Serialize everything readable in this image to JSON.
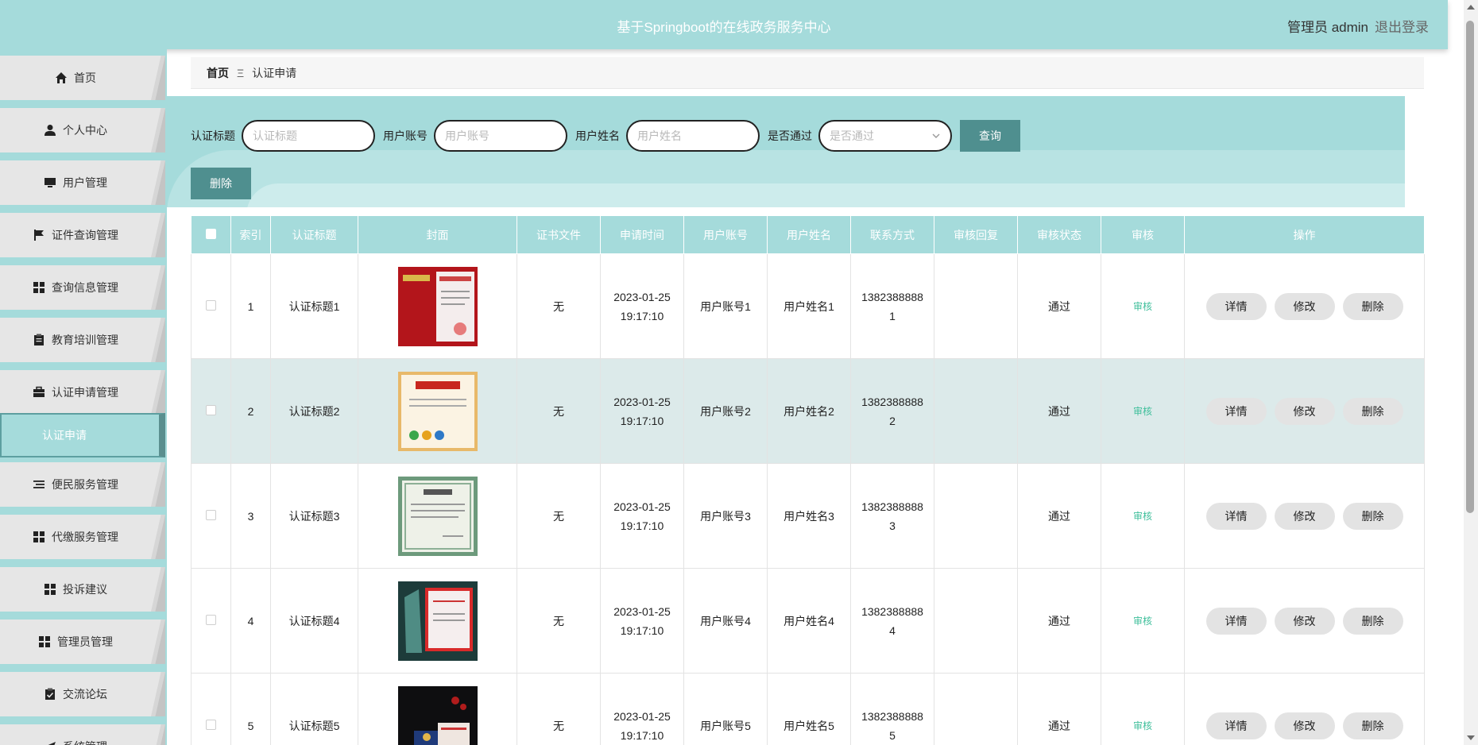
{
  "header": {
    "title": "基于Springboot的在线政务服务中心",
    "user_label": "管理员 admin",
    "logout_label": "退出登录",
    "color": "#a5dbdb"
  },
  "sidebar": {
    "items": [
      {
        "label": "首页",
        "icon": "home-icon"
      },
      {
        "label": "个人中心",
        "icon": "person-icon"
      },
      {
        "label": "用户管理",
        "icon": "monitor-icon"
      },
      {
        "label": "证件查询管理",
        "icon": "flag-icon"
      },
      {
        "label": "查询信息管理",
        "icon": "grid-icon"
      },
      {
        "label": "教育培训管理",
        "icon": "clipboard-icon"
      },
      {
        "label": "认证申请管理",
        "icon": "briefcase-icon"
      },
      {
        "label": "便民服务管理",
        "icon": "list-icon"
      },
      {
        "label": "代缴服务管理",
        "icon": "grid-icon"
      },
      {
        "label": "投诉建议",
        "icon": "grid-icon"
      },
      {
        "label": "管理员管理",
        "icon": "grid-icon"
      },
      {
        "label": "交流论坛",
        "icon": "clipboard-check-icon"
      },
      {
        "label": "系统管理",
        "icon": "send-icon"
      }
    ],
    "active_sub": "认证申请"
  },
  "breadcrumb": {
    "home": "首页",
    "separator": "Ξ",
    "current": "认证申请"
  },
  "search": {
    "fields": [
      {
        "label": "认证标题",
        "placeholder": "认证标题"
      },
      {
        "label": "用户账号",
        "placeholder": "用户账号"
      },
      {
        "label": "用户姓名",
        "placeholder": "用户姓名"
      }
    ],
    "select": {
      "label": "是否通过",
      "placeholder": "是否通过"
    },
    "query_label": "查询",
    "delete_label": "删除"
  },
  "table": {
    "headers": [
      "索引",
      "认证标题",
      "封面",
      "证书文件",
      "申请时间",
      "用户账号",
      "用户姓名",
      "联系方式",
      "审核回复",
      "审核状态",
      "审核",
      "操作"
    ],
    "rows": [
      {
        "index": "1",
        "title": "认证标题1",
        "file": "无",
        "date": "2023-01-25",
        "time": "19:17:10",
        "account": "用户账号1",
        "name": "用户姓名1",
        "phone": "13823888881",
        "reply": "",
        "status": "通过",
        "audit": "审核",
        "cover": "red"
      },
      {
        "index": "2",
        "title": "认证标题2",
        "file": "无",
        "date": "2023-01-25",
        "time": "19:17:10",
        "account": "用户账号2",
        "name": "用户姓名2",
        "phone": "13823888882",
        "reply": "",
        "status": "通过",
        "audit": "审核",
        "cover": "gold"
      },
      {
        "index": "3",
        "title": "认证标题3",
        "file": "无",
        "date": "2023-01-25",
        "time": "19:17:10",
        "account": "用户账号3",
        "name": "用户姓名3",
        "phone": "13823888883",
        "reply": "",
        "status": "通过",
        "audit": "审核",
        "cover": "green"
      },
      {
        "index": "4",
        "title": "认证标题4",
        "file": "无",
        "date": "2023-01-25",
        "time": "19:17:10",
        "account": "用户账号4",
        "name": "用户姓名4",
        "phone": "13823888884",
        "reply": "",
        "status": "通过",
        "audit": "审核",
        "cover": "dark"
      },
      {
        "index": "5",
        "title": "认证标题5",
        "file": "无",
        "date": "2023-01-25",
        "time": "19:17:10",
        "account": "用户账号5",
        "name": "用户姓名5",
        "phone": "13823888885",
        "reply": "",
        "status": "通过",
        "audit": "审核",
        "cover": "black"
      }
    ],
    "actions": {
      "detail": "详情",
      "edit": "修改",
      "delete": "删除"
    }
  }
}
